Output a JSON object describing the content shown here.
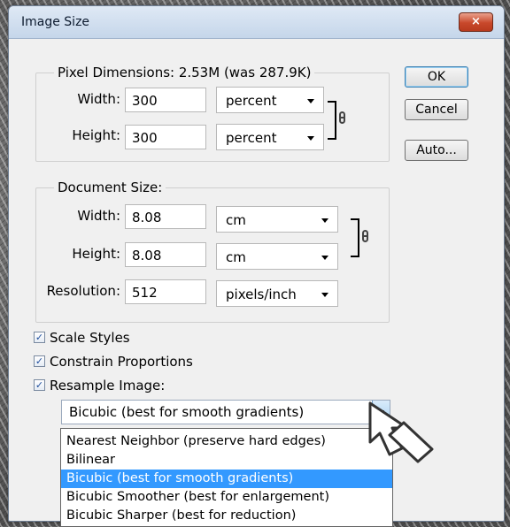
{
  "window": {
    "title": "Image Size",
    "close_label": "×"
  },
  "pixel_dimensions": {
    "legend": "Pixel Dimensions:  2.53M (was 287.9K)",
    "width_label": "Width:",
    "width_value": "300",
    "width_unit": "percent",
    "height_label": "Height:",
    "height_value": "300",
    "height_unit": "percent"
  },
  "document_size": {
    "legend": "Document Size:",
    "width_label": "Width:",
    "width_value": "8.08",
    "width_unit": "cm",
    "height_label": "Height:",
    "height_value": "8.08",
    "height_unit": "cm",
    "resolution_label": "Resolution:",
    "resolution_value": "512",
    "resolution_unit": "pixels/inch"
  },
  "buttons": {
    "ok": "OK",
    "cancel": "Cancel",
    "auto": "Auto..."
  },
  "options": {
    "scale_styles": {
      "label": "Scale Styles",
      "checked": true
    },
    "constrain_proportions": {
      "label": "Constrain Proportions",
      "checked": true
    },
    "resample_image": {
      "label": "Resample Image:",
      "checked": true
    }
  },
  "resample": {
    "selected": "Bicubic (best for smooth gradients)",
    "options": [
      "Nearest Neighbor (preserve hard edges)",
      "Bilinear",
      "Bicubic (best for smooth gradients)",
      "Bicubic Smoother (best for enlargement)",
      "Bicubic Sharper (best for reduction)"
    ],
    "selected_index": 2
  },
  "icons": {
    "close": "close-icon",
    "link": "link-icon",
    "dropdown": "chevron-down-icon",
    "cursor": "mouse-cursor-icon"
  }
}
